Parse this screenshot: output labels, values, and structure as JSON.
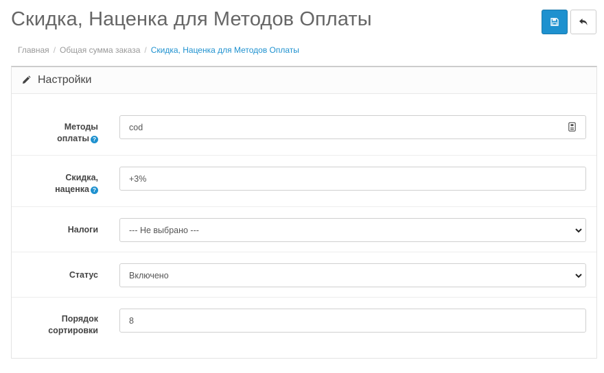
{
  "page": {
    "title": "Скидка, Наценка для Методов Оплаты"
  },
  "toolbar": {
    "save_icon": "floppy-disk-icon",
    "back_icon": "reply-arrow-icon"
  },
  "breadcrumb": {
    "items": [
      "Главная",
      "Общая сумма заказа",
      "Скидка, Наценка для Методов Оплаты"
    ]
  },
  "panel": {
    "heading": "Настройки",
    "heading_icon": "pencil-icon"
  },
  "form": {
    "payment_methods": {
      "label_line1": "Методы",
      "label_line2": "оплаты",
      "value": "cod"
    },
    "discount": {
      "label_line1": "Скидка,",
      "label_line2": "наценка",
      "value": "+3%"
    },
    "taxes": {
      "label": "Налоги",
      "selected": "--- Не выбрано ---"
    },
    "status": {
      "label": "Статус",
      "selected": "Включено"
    },
    "sort_order": {
      "label_line1": "Порядок",
      "label_line2": "сортировки",
      "value": "8"
    }
  },
  "colors": {
    "primary": "#1e91cf",
    "title": "#666666"
  }
}
